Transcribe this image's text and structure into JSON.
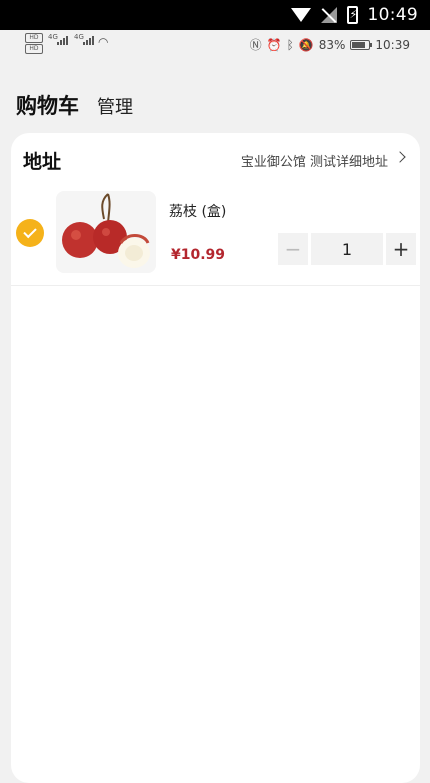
{
  "system_status": {
    "time": "10:49"
  },
  "status_bar": {
    "network_1": "4G",
    "network_2": "4G",
    "battery_percent": "83%",
    "time": "10:39"
  },
  "header": {
    "title": "购物车",
    "manage_label": "管理"
  },
  "address": {
    "label": "地址",
    "value": "宝业御公馆 测试详细地址"
  },
  "cart": {
    "items": [
      {
        "name": "荔枝 (盒)",
        "price": "¥10.99",
        "quantity": "1",
        "checked": true
      }
    ]
  },
  "stepper": {
    "minus": "−",
    "plus": "+"
  },
  "colors": {
    "accent": "#f5b21a",
    "price": "#b3262e",
    "background": "#f1f1f1"
  }
}
